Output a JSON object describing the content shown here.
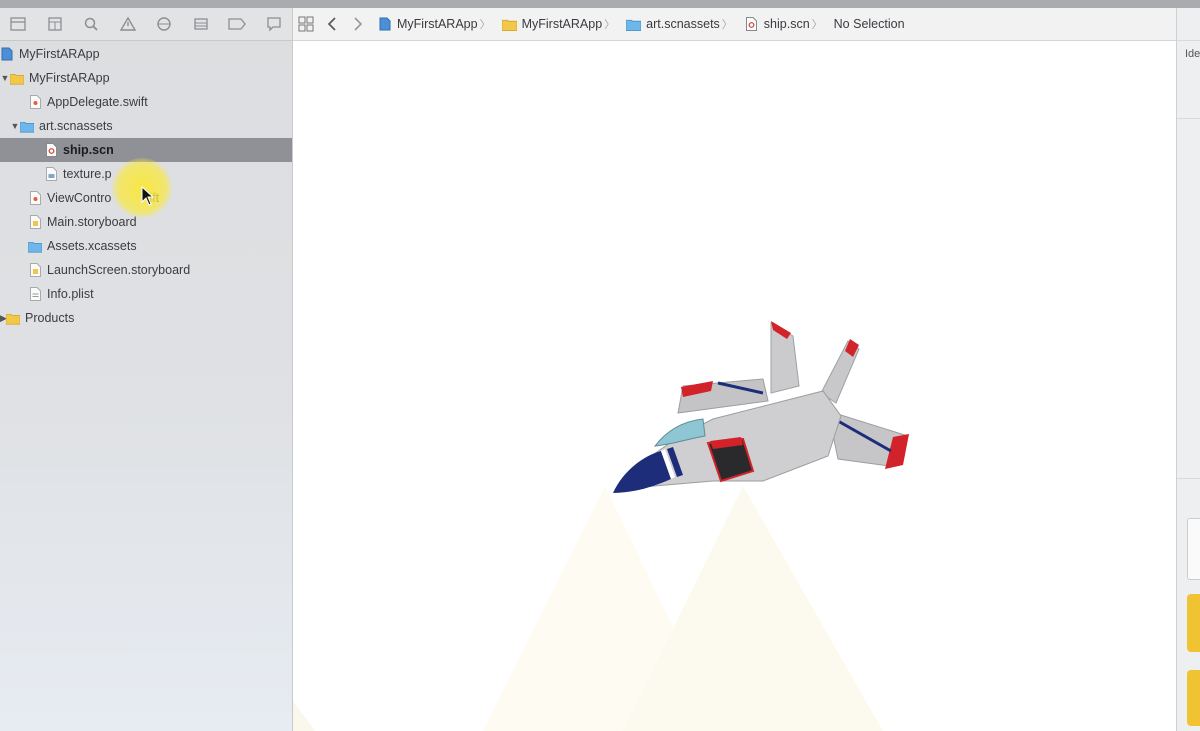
{
  "breadcrumbs": [
    {
      "label": "MyFirstARApp",
      "icon": "project-icon"
    },
    {
      "label": "MyFirstARApp",
      "icon": "folder-icon"
    },
    {
      "label": "art.scnassets",
      "icon": "blue-folder-icon"
    },
    {
      "label": "ship.scn",
      "icon": "scene-file-icon"
    },
    {
      "label": "No Selection",
      "icon": ""
    }
  ],
  "navigator": {
    "toolbar_icons": [
      "folder-icon",
      "source-control-icon",
      "search-icon",
      "warning-icon",
      "test-icon",
      "debug-icon",
      "breakpoint-icon",
      "report-icon"
    ],
    "items": [
      {
        "label": "MyFirstARApp",
        "indent": 0,
        "icon": "project-icon",
        "disclosure": ""
      },
      {
        "label": "MyFirstARApp",
        "indent": 0,
        "icon": "folder-icon",
        "disclosure": "▼"
      },
      {
        "label": "AppDelegate.swift",
        "indent": 2,
        "icon": "swift-file-icon",
        "disclosure": ""
      },
      {
        "label": "art.scnassets",
        "indent": 1,
        "icon": "blue-folder-icon",
        "disclosure": "▼"
      },
      {
        "label": "ship.scn",
        "indent": 3,
        "icon": "scene-file-icon",
        "disclosure": "",
        "selected": true
      },
      {
        "label": "texture.p",
        "indent": 3,
        "icon": "image-file-icon",
        "disclosure": ""
      },
      {
        "label": "ViewContro",
        "label_tail": "ift",
        "indent": 2,
        "icon": "swift-file-icon",
        "disclosure": ""
      },
      {
        "label": "Main.storyboard",
        "indent": 2,
        "icon": "storyboard-file-icon",
        "disclosure": ""
      },
      {
        "label": "Assets.xcassets",
        "indent": 2,
        "icon": "blue-folder-icon",
        "disclosure": ""
      },
      {
        "label": "LaunchScreen.storyboard",
        "indent": 2,
        "icon": "storyboard-file-icon",
        "disclosure": ""
      },
      {
        "label": "Info.plist",
        "indent": 2,
        "icon": "plist-file-icon",
        "disclosure": ""
      },
      {
        "label": "Products",
        "indent": 0,
        "icon": "folder-icon",
        "disclosure": "▶"
      }
    ]
  },
  "inspector": {
    "label": "Ide"
  },
  "colors": {
    "selected_row": "#8f9196",
    "folder": "#f3c84a",
    "blue_folder": "#6fb7ea",
    "ship_body": "#c9c9cb",
    "ship_red": "#d2232a",
    "ship_blue": "#1d2d7a",
    "cursor_halo": "#f9e83c"
  }
}
